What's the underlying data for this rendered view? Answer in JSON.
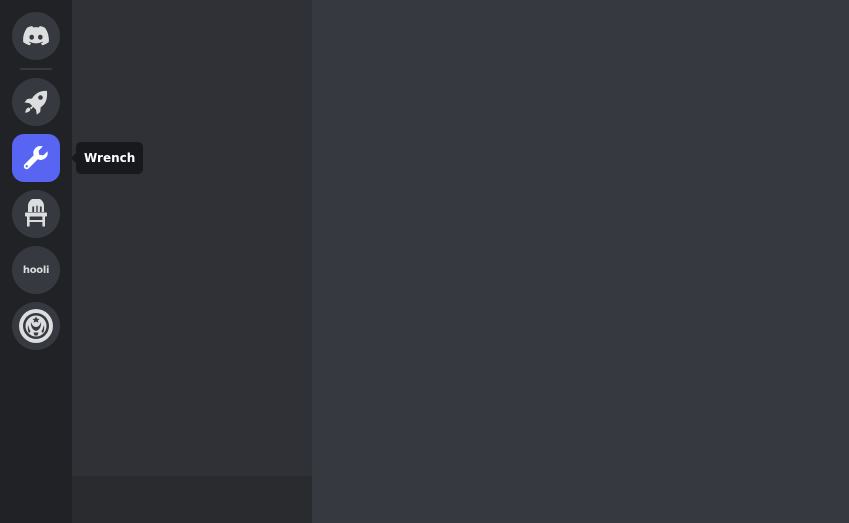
{
  "server_rail": {
    "home_icon": "discord-logo-icon",
    "servers": [
      {
        "icon": "rocket-icon",
        "active": false
      },
      {
        "icon": "wrench-icon",
        "active": true
      },
      {
        "icon": "chair-icon",
        "active": false
      },
      {
        "icon": "hooli-logo-icon",
        "text": "hooli",
        "active": false
      },
      {
        "icon": "starbucks-logo-icon",
        "active": false
      }
    ]
  },
  "tooltip": {
    "label": "Wrench"
  },
  "colors": {
    "rail_bg": "#202225",
    "sidebar_bg": "#2f3136",
    "user_panel_bg": "#292b2f",
    "main_bg": "#36393f",
    "accent": "#5865f2",
    "tooltip_bg": "#18191c"
  }
}
